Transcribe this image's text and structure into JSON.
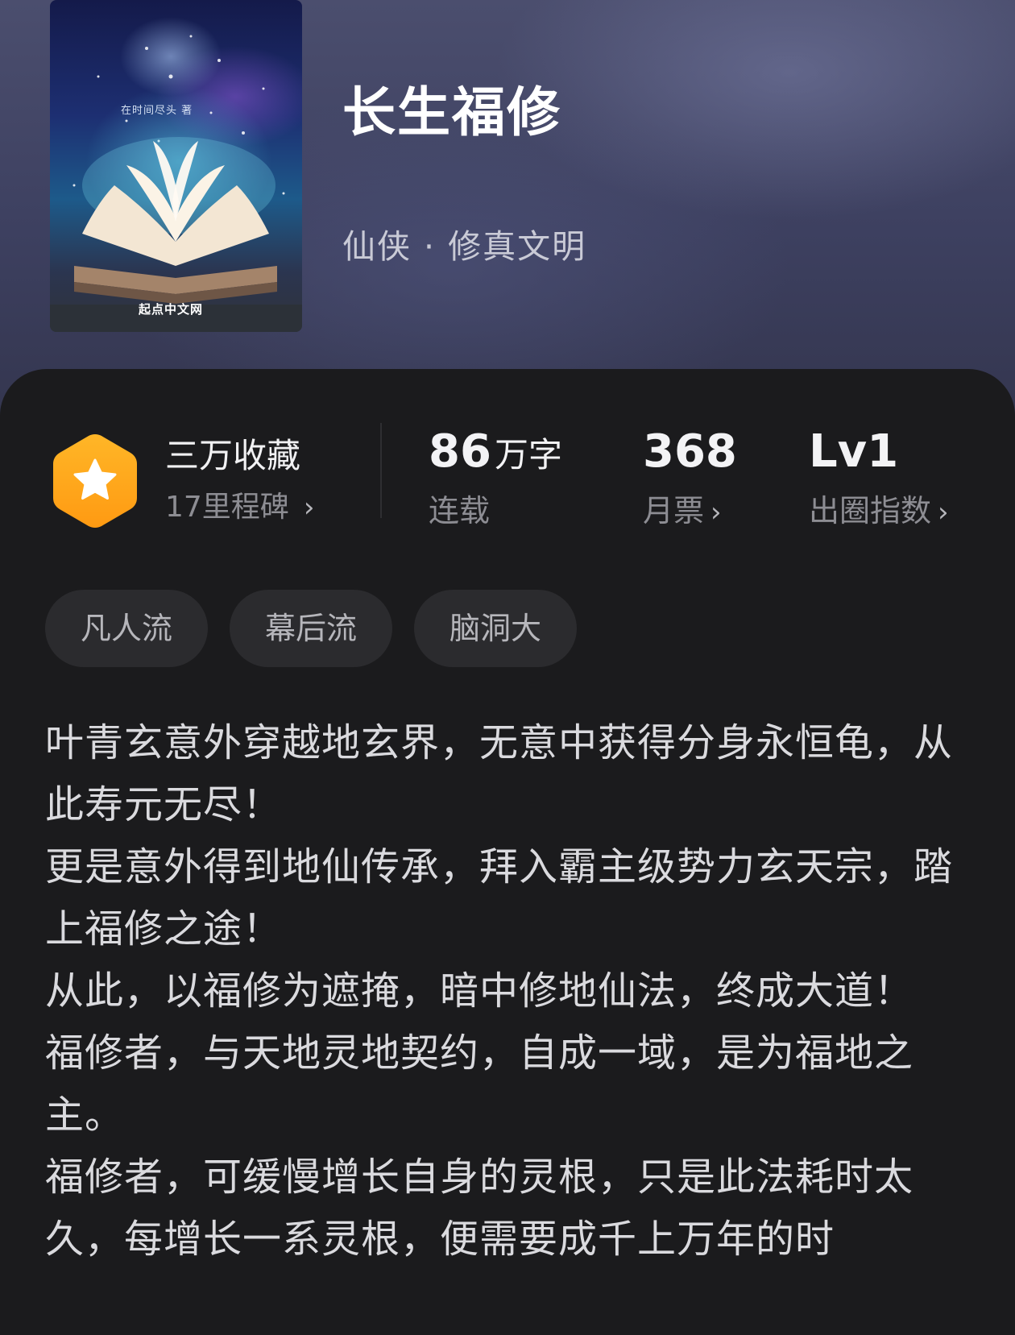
{
  "book": {
    "title": "长生福修",
    "genre": "仙侠 · 修真文明",
    "cover": {
      "author_text": "在时间尽头 著",
      "publisher": "起点中文网"
    }
  },
  "stats": {
    "favorites": {
      "value": "三万收藏",
      "milestone": "17里程碑",
      "chevron": "›"
    },
    "words": {
      "number": "86",
      "unit": "万字",
      "label": "连载"
    },
    "monthly_votes": {
      "value": "368",
      "label": "月票",
      "chevron": "›"
    },
    "circle_index": {
      "value": "Lv1",
      "label": "出圈指数",
      "chevron": "›"
    }
  },
  "tags": [
    "凡人流",
    "幕后流",
    "脑洞大"
  ],
  "description": [
    "叶青玄意外穿越地玄界，无意中获得分身永恒龟，从此寿元无尽！",
    "更是意外得到地仙传承，拜入霸主级势力玄天宗，踏上福修之途！",
    "从此，以福修为遮掩，暗中修地仙法，终成大道！",
    "福修者，与天地灵地契约，自成一域，是为福地之主。",
    "福修者，可缓慢增长自身的灵根，只是此法耗时太久，每增长一系灵根，便需要成千上万年的时"
  ],
  "colors": {
    "hero_bg": "#3d4060",
    "panel_bg": "#1b1b1d",
    "badge_orange": "#ffa51f",
    "tag_bg": "#2b2b2e"
  },
  "icons": {
    "favorites_badge": "hexagon-star-icon",
    "chevron": "chevron-right-icon"
  }
}
